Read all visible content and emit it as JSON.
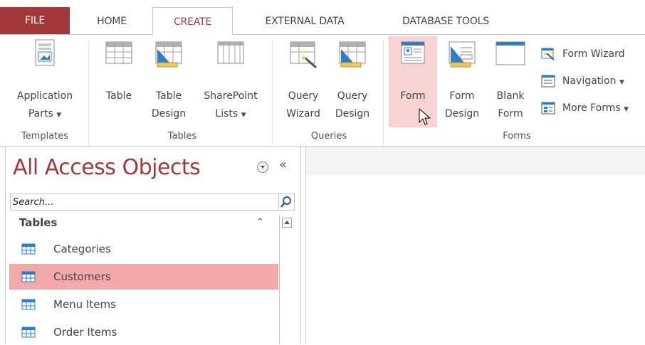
{
  "tabs": {
    "file": "FILE",
    "home": "HOME",
    "create": "CREATE",
    "external_data": "EXTERNAL DATA",
    "database_tools": "DATABASE TOOLS"
  },
  "ribbon": {
    "templates": {
      "label": "Templates",
      "application_parts": {
        "line1": "Application",
        "line2": "Parts"
      }
    },
    "tables": {
      "label": "Tables",
      "table": "Table",
      "table_design": {
        "line1": "Table",
        "line2": "Design"
      },
      "sharepoint_lists": {
        "line1": "SharePoint",
        "line2": "Lists"
      }
    },
    "queries": {
      "label": "Queries",
      "query_wizard": {
        "line1": "Query",
        "line2": "Wizard"
      },
      "query_design": {
        "line1": "Query",
        "line2": "Design"
      }
    },
    "forms": {
      "label": "Forms",
      "form": "Form",
      "form_design": {
        "line1": "Form",
        "line2": "Design"
      },
      "blank_form": {
        "line1": "Blank",
        "line2": "Form"
      },
      "form_wizard": "Form Wizard",
      "navigation": "Navigation",
      "more_forms": "More Forms"
    }
  },
  "nav_pane": {
    "title": "All Access Objects",
    "search_placeholder": "Search...",
    "section": "Tables",
    "items": [
      {
        "label": "Categories",
        "selected": false
      },
      {
        "label": "Customers",
        "selected": true
      },
      {
        "label": "Menu Items",
        "selected": false
      },
      {
        "label": "Order Items",
        "selected": false
      }
    ]
  },
  "colors": {
    "accent": "#a4373a",
    "hover": "#f8d3d4",
    "selection": "#f4a9a9",
    "icon_blue": "#2b7cd3"
  },
  "icons": [
    "application-parts-icon",
    "table-icon",
    "table-design-icon",
    "sharepoint-lists-icon",
    "query-wizard-icon",
    "query-design-icon",
    "form-icon",
    "form-design-icon",
    "blank-form-icon",
    "form-wizard-icon",
    "navigation-icon",
    "more-forms-icon",
    "search-icon",
    "shutter-bar-icon",
    "mouse-pointer-icon"
  ]
}
